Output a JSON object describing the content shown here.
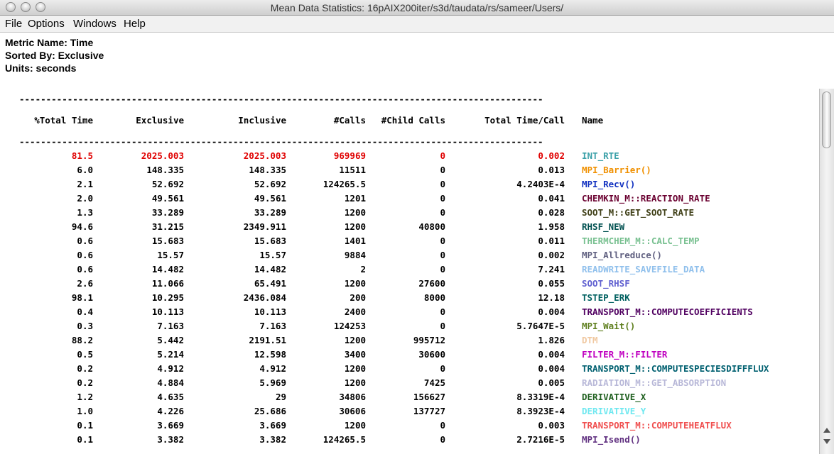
{
  "window": {
    "title": "Mean Data Statistics: 16pAIX200iter/s3d/taudata/rs/sameer/Users/"
  },
  "menu": [
    "File",
    "Options",
    "Windows",
    "Help"
  ],
  "info": {
    "metric": "Metric Name: Time",
    "sorted": "Sorted By: Exclusive",
    "units": "Units: seconds"
  },
  "table": {
    "rule": "--------------------------------------------------------------------------------------------------",
    "columns": [
      "%Total Time",
      "Exclusive",
      "Inclusive",
      "#Calls",
      "#Child Calls",
      "Total Time/Call",
      "Name"
    ],
    "rows": [
      {
        "cells": [
          "81.5",
          "2025.003",
          "2025.003",
          "969969",
          "0",
          "0.002"
        ],
        "name": "INT_RTE",
        "color": "#3aa0a8",
        "highlight": "#e00000"
      },
      {
        "cells": [
          "6.0",
          "148.335",
          "148.335",
          "11511",
          "0",
          "0.013"
        ],
        "name": "MPI_Barrier()",
        "color": "#f09000"
      },
      {
        "cells": [
          "2.1",
          "52.692",
          "52.692",
          "124265.5",
          "0",
          "4.2403E-4"
        ],
        "name": "MPI_Recv()",
        "color": "#1030c0"
      },
      {
        "cells": [
          "2.0",
          "49.561",
          "49.561",
          "1201",
          "0",
          "0.041"
        ],
        "name": "CHEMKIN_M::REACTION_RATE",
        "color": "#6a0030"
      },
      {
        "cells": [
          "1.3",
          "33.289",
          "33.289",
          "1200",
          "0",
          "0.028"
        ],
        "name": "SOOT_M::GET_SOOT_RATE",
        "color": "#404018"
      },
      {
        "cells": [
          "94.6",
          "31.215",
          "2349.911",
          "1200",
          "40800",
          "1.958"
        ],
        "name": "RHSF_NEW",
        "color": "#005050"
      },
      {
        "cells": [
          "0.6",
          "15.683",
          "15.683",
          "1401",
          "0",
          "0.011"
        ],
        "name": "THERMCHEM_M::CALC_TEMP",
        "color": "#78c090"
      },
      {
        "cells": [
          "0.6",
          "15.57",
          "15.57",
          "9884",
          "0",
          "0.002"
        ],
        "name": "MPI_Allreduce()",
        "color": "#606080"
      },
      {
        "cells": [
          "0.6",
          "14.482",
          "14.482",
          "2",
          "0",
          "7.241"
        ],
        "name": "READWRITE_SAVEFILE_DATA",
        "color": "#90c0ec"
      },
      {
        "cells": [
          "2.6",
          "11.066",
          "65.491",
          "1200",
          "27600",
          "0.055"
        ],
        "name": "SOOT_RHSF",
        "color": "#6060d0"
      },
      {
        "cells": [
          "98.1",
          "10.295",
          "2436.084",
          "200",
          "8000",
          "12.18"
        ],
        "name": "TSTEP_ERK",
        "color": "#006060"
      },
      {
        "cells": [
          "0.4",
          "10.113",
          "10.113",
          "2400",
          "0",
          "0.004"
        ],
        "name": "TRANSPORT_M::COMPUTECOEFFICIENTS",
        "color": "#500060"
      },
      {
        "cells": [
          "0.3",
          "7.163",
          "7.163",
          "124253",
          "0",
          "5.7647E-5"
        ],
        "name": "MPI_Wait()",
        "color": "#608020"
      },
      {
        "cells": [
          "88.2",
          "5.442",
          "2191.51",
          "1200",
          "995712",
          "1.826"
        ],
        "name": "DTM",
        "color": "#f0c8a0"
      },
      {
        "cells": [
          "0.5",
          "5.214",
          "12.598",
          "3400",
          "30600",
          "0.004"
        ],
        "name": "FILTER_M::FILTER",
        "color": "#c000c0"
      },
      {
        "cells": [
          "0.2",
          "4.912",
          "4.912",
          "1200",
          "0",
          "0.004"
        ],
        "name": "TRANSPORT_M::COMPUTESPECIESDIFFFLUX",
        "color": "#006070"
      },
      {
        "cells": [
          "0.2",
          "4.884",
          "5.969",
          "1200",
          "7425",
          "0.005"
        ],
        "name": "RADIATION_M::GET_ABSORPTION",
        "color": "#b8b8d8"
      },
      {
        "cells": [
          "1.2",
          "4.635",
          "29",
          "34806",
          "156627",
          "8.3319E-4"
        ],
        "name": "DERIVATIVE_X",
        "color": "#206020"
      },
      {
        "cells": [
          "1.0",
          "4.226",
          "25.686",
          "30606",
          "137727",
          "8.3923E-4"
        ],
        "name": "DERIVATIVE_Y",
        "color": "#70e8f0"
      },
      {
        "cells": [
          "0.1",
          "3.669",
          "3.669",
          "1200",
          "0",
          "0.003"
        ],
        "name": "TRANSPORT_M::COMPUTEHEATFLUX",
        "color": "#f05050"
      },
      {
        "cells": [
          "0.1",
          "3.382",
          "3.382",
          "124265.5",
          "0",
          "2.7216E-5"
        ],
        "name": "MPI_Isend()",
        "color": "#603080"
      }
    ]
  }
}
